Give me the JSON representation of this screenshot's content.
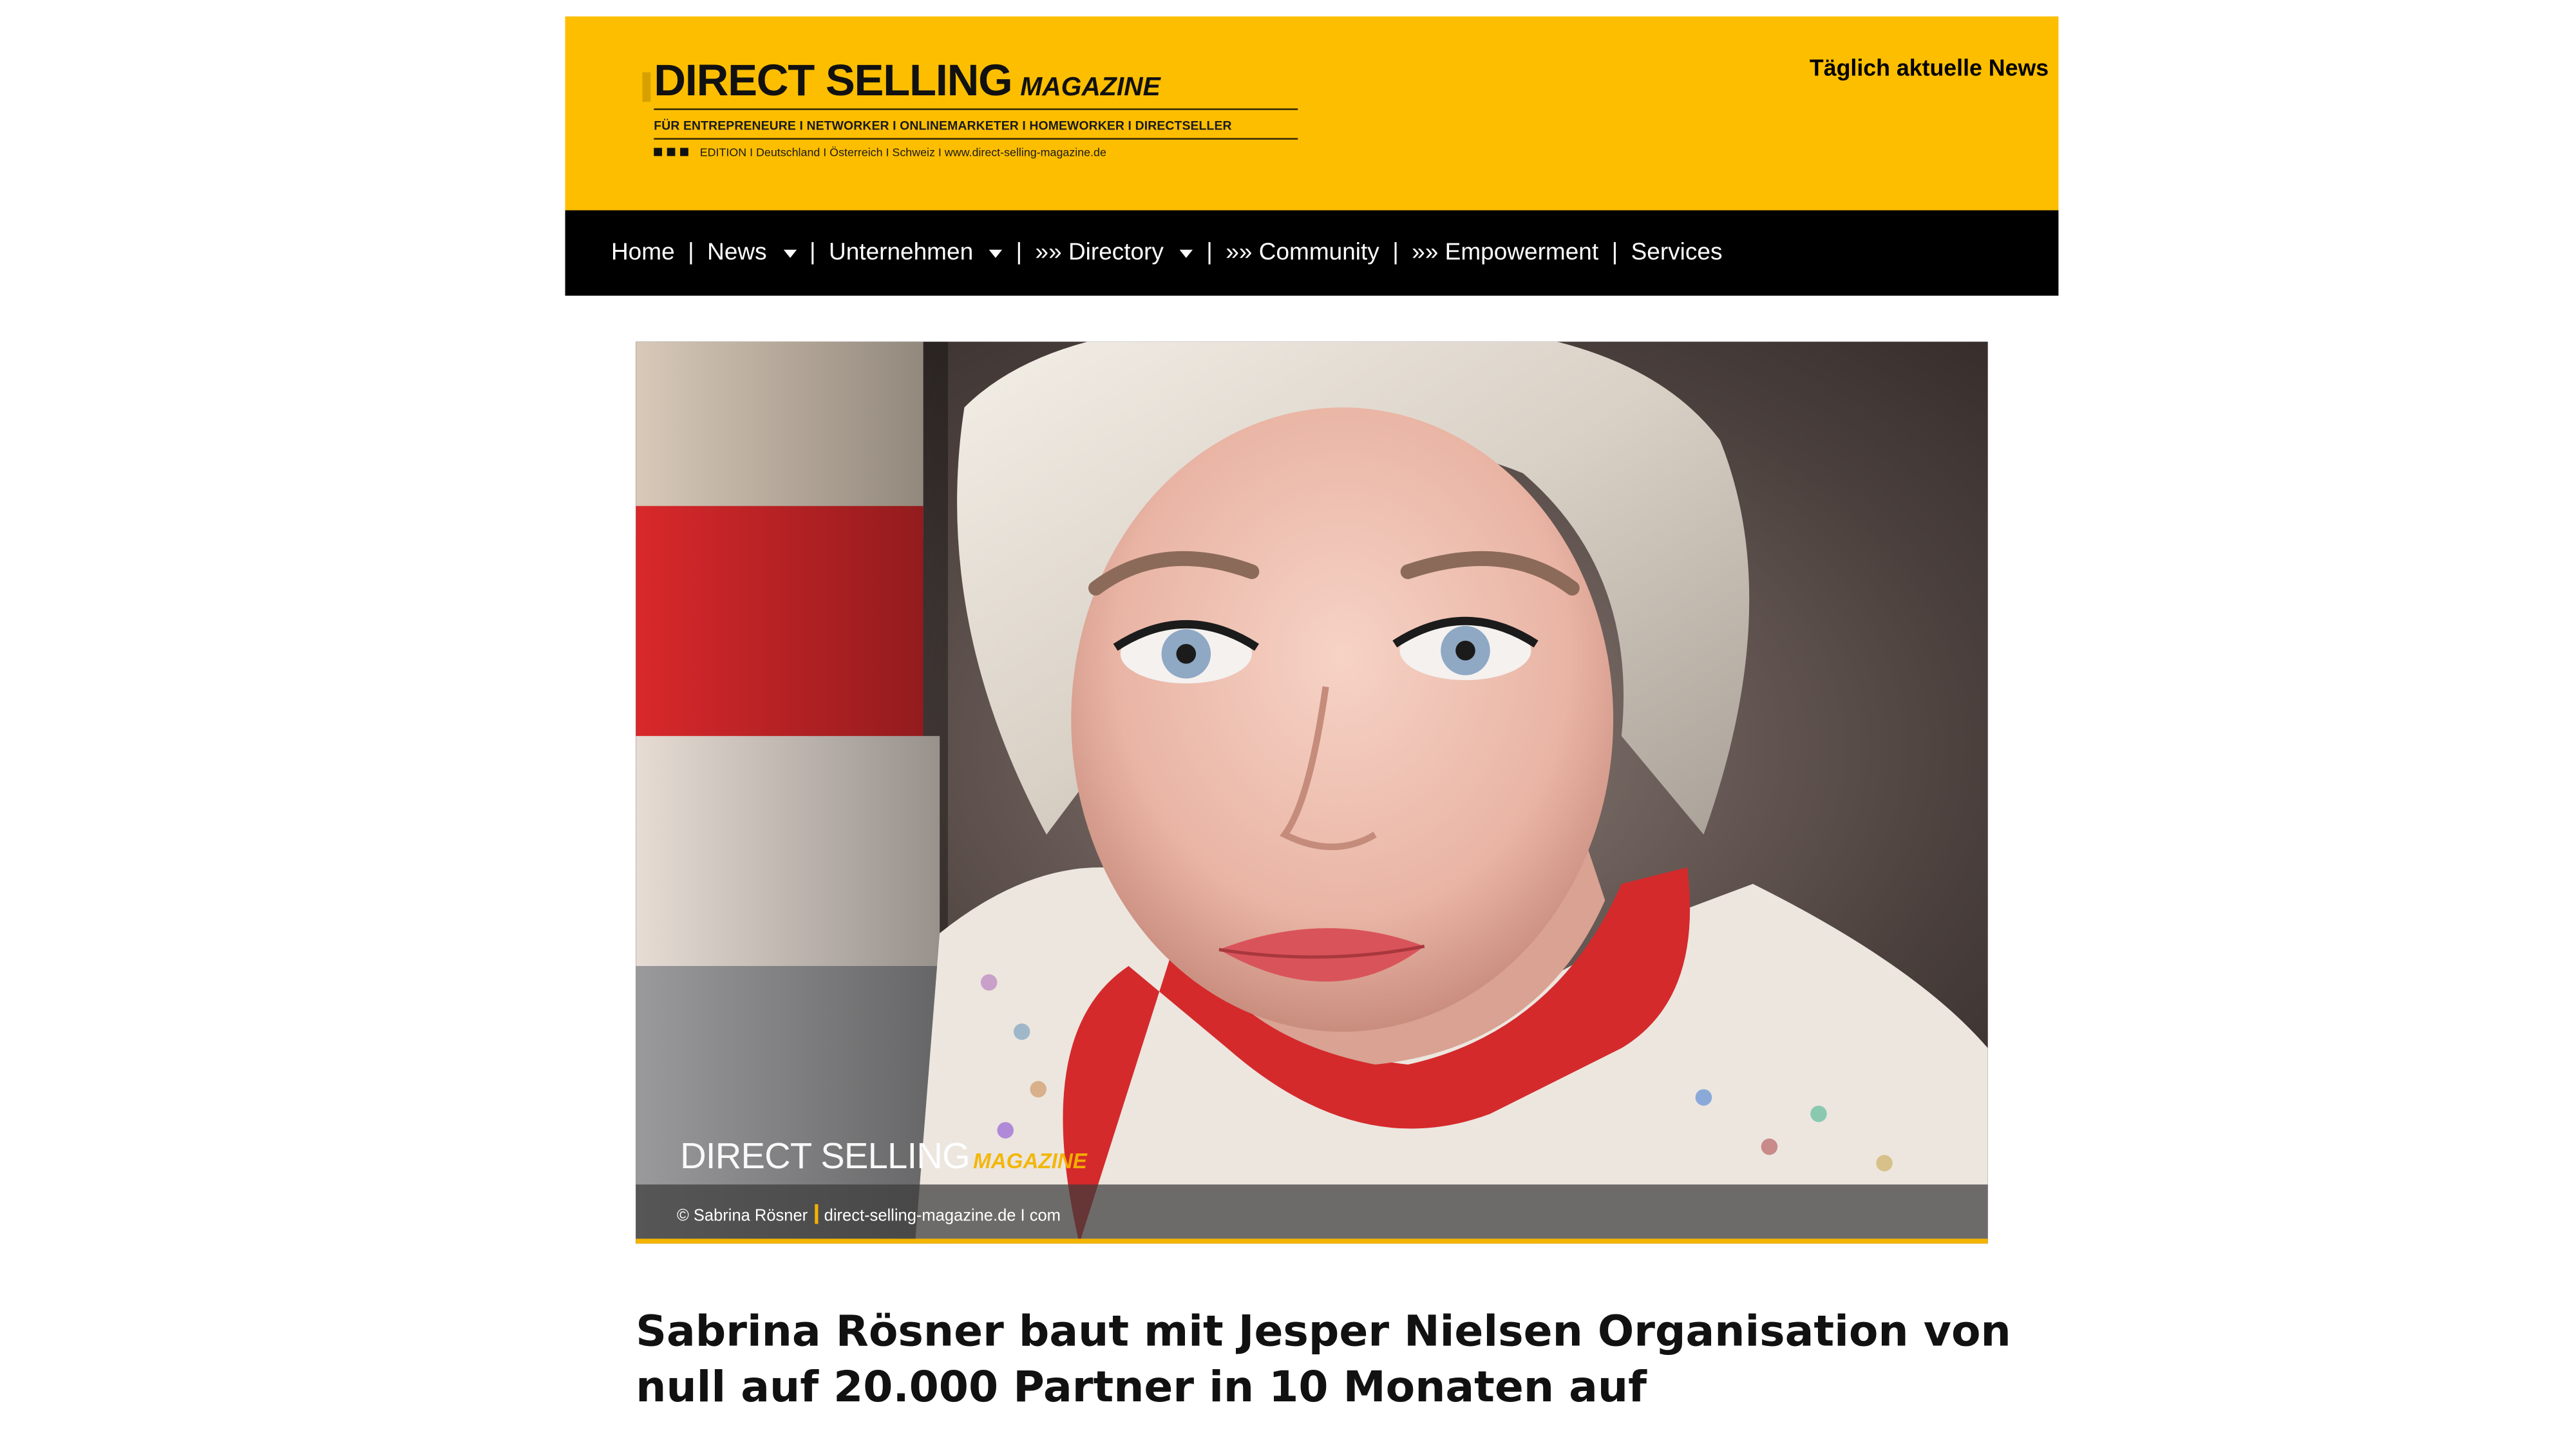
{
  "header": {
    "logo": {
      "title": "DIRECT SELLING",
      "subtitle": "MAGAZINE",
      "tagline": "FÜR ENTREPRENEURE I NETWORKER I ONLINEMARKETER I HOMEWORKER I DIRECTSELLER",
      "edition": "EDITION I Deutschland I Österreich I Schweiz I www.direct-selling-magazine.de"
    },
    "news_link": "Täglich aktuelle News",
    "background_color": "#fdbe00"
  },
  "nav": {
    "separator": "|",
    "items": [
      {
        "label": "Home"
      },
      {
        "label": "News",
        "icon": "chevron-down-icon"
      },
      {
        "label": "Unternehmen",
        "icon": "chevron-down-icon"
      },
      {
        "label": "»» Directory",
        "icon": "chevron-down-icon"
      },
      {
        "label": "»» Community"
      },
      {
        "label": "»» Empowerment"
      },
      {
        "label": "Services"
      }
    ]
  },
  "hero": {
    "watermark_title": "DIRECT SELLING",
    "watermark_subtitle": "MAGAZINE",
    "credit_name": "© Sabrina Rösner",
    "credit_site": "direct-selling-magazine.de I com",
    "accent_color": "#f3b400"
  },
  "article": {
    "headline": "Sabrina Rösner baut mit Jesper Nielsen Organisation von null auf 20.000 Partner in 10 Monaten auf"
  }
}
